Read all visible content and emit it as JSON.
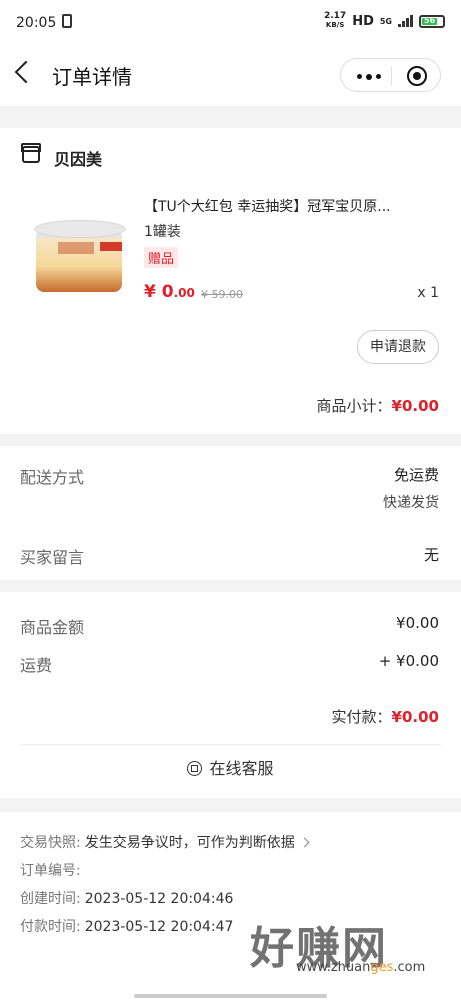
{
  "status_bar": {
    "time": "20:05",
    "net_speed": "2.17",
    "net_unit": "KB/S",
    "hd": "HD",
    "network": "5G",
    "battery": "56"
  },
  "nav": {
    "title": "订单详情"
  },
  "shop": {
    "name": "贝因美"
  },
  "product": {
    "title": "【TU个大红包 幸运抽奖】冠军宝贝原...",
    "spec": "1罐装",
    "tag": "赠品",
    "price_symbol": "¥",
    "price_int": "0",
    "price_dec": ".00",
    "original_price": "¥ 59.00",
    "quantity": "x 1",
    "refund_label": "申请退款"
  },
  "subtotal": {
    "label": "商品小计：",
    "amount": "¥0.00"
  },
  "shipping": {
    "label": "配送方式",
    "value": "免运费",
    "sub_value": "快递发货"
  },
  "buyer_note": {
    "label": "买家留言",
    "value": "无"
  },
  "fees": {
    "goods_label": "商品金额",
    "goods_value": "¥0.00",
    "freight_label": "运费",
    "freight_value": "+ ¥0.00",
    "paid_label": "实付款：",
    "paid_amount": "¥0.00",
    "service_label": "在线客服"
  },
  "order_info": {
    "snapshot_label": "交易快照:",
    "snapshot_value": "发生交易争议时，可作为判断依据",
    "order_no_label": "订单编号:",
    "created_label": "创建时间:",
    "created_value": "2023-05-12 20:04:46",
    "paid_label": "付款时间:",
    "paid_value": "2023-05-12 20:04:47"
  },
  "watermark": {
    "text": "好赚网",
    "url_a": "www.zhuan",
    "url_o": "ges",
    "url_b": ".com"
  },
  "colors": {
    "accent_red": "#e0212a",
    "background": "#f3f3f3"
  }
}
